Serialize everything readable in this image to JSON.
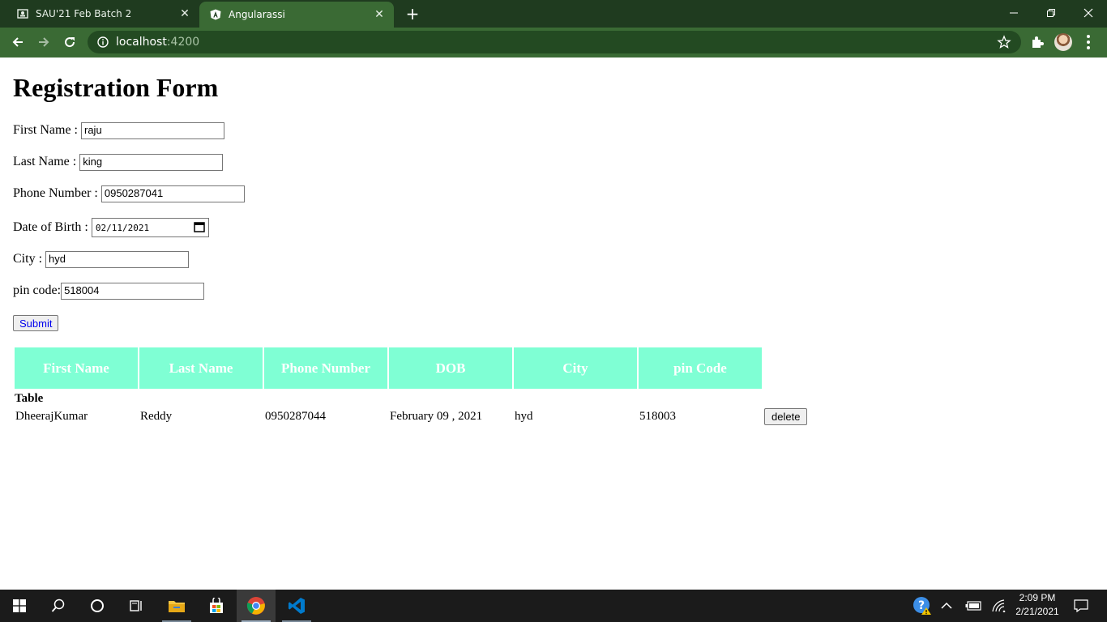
{
  "browser": {
    "tabs": [
      {
        "title": "SAU'21 Feb Batch 2",
        "favicon": "classroom-icon",
        "active": false
      },
      {
        "title": "Angularassi",
        "favicon": "angular-icon",
        "active": true
      }
    ],
    "url_host": "localhost",
    "url_port": ":4200"
  },
  "form": {
    "heading": "Registration Form",
    "first_name_label": "First Name :",
    "first_name_value": "raju",
    "last_name_label": "Last Name :",
    "last_name_value": "king",
    "phone_label": "Phone Number :",
    "phone_value": "0950287041",
    "dob_label": "Date of Birth :",
    "dob_value": "02/11/2021",
    "city_label": "City :",
    "city_value": "hyd",
    "pin_label": "pin code:",
    "pin_value": "518004",
    "submit_label": "Submit"
  },
  "table": {
    "headers": [
      "First Name",
      "Last Name",
      "Phone Number",
      "DOB",
      "City",
      "pin Code"
    ],
    "caption": "Table",
    "rows": [
      {
        "first_name": "DheerajKumar",
        "last_name": "Reddy",
        "phone": "0950287044",
        "dob": "February 09 , 2021",
        "city": "hyd",
        "pin": "518003",
        "action_label": "delete"
      }
    ],
    "header_color": "#7fffd4"
  },
  "taskbar": {
    "time": "2:09 PM",
    "date": "2/21/2021"
  },
  "colors": {
    "tab_strip": "#1f3b1f",
    "toolbar": "#3a6a34",
    "omnibox": "#234a22"
  }
}
